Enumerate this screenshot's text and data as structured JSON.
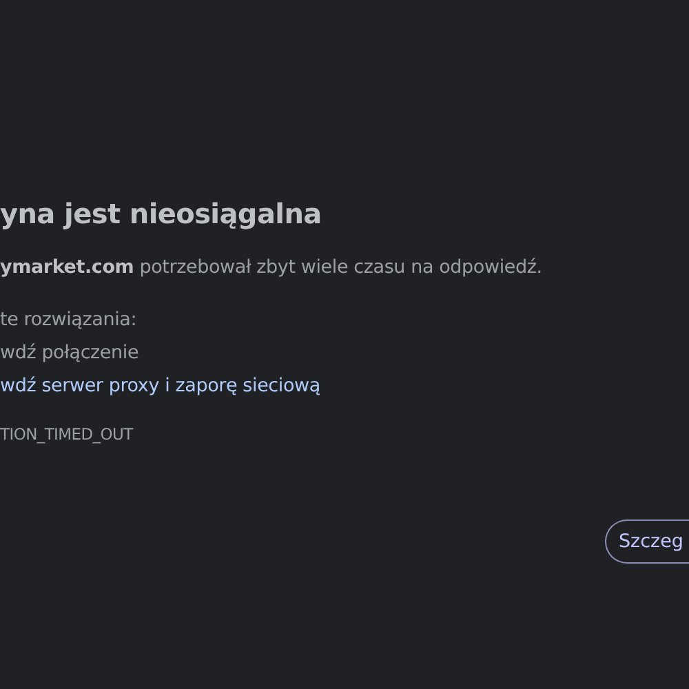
{
  "heading": "yna jest nieosiągalna",
  "message": {
    "host": "ymarket.com",
    "text": "potrzebował zbyt wiele czasu na odpowiedź."
  },
  "suggestions_label": "te rozwiązania:",
  "suggestions": [
    {
      "kind": "text",
      "label": "wdź połączenie"
    },
    {
      "kind": "link",
      "label": "wdź serwer proxy i zaporę sieciową"
    }
  ],
  "error_code": "TION_TIMED_OUT",
  "details_button": "Szczeg"
}
